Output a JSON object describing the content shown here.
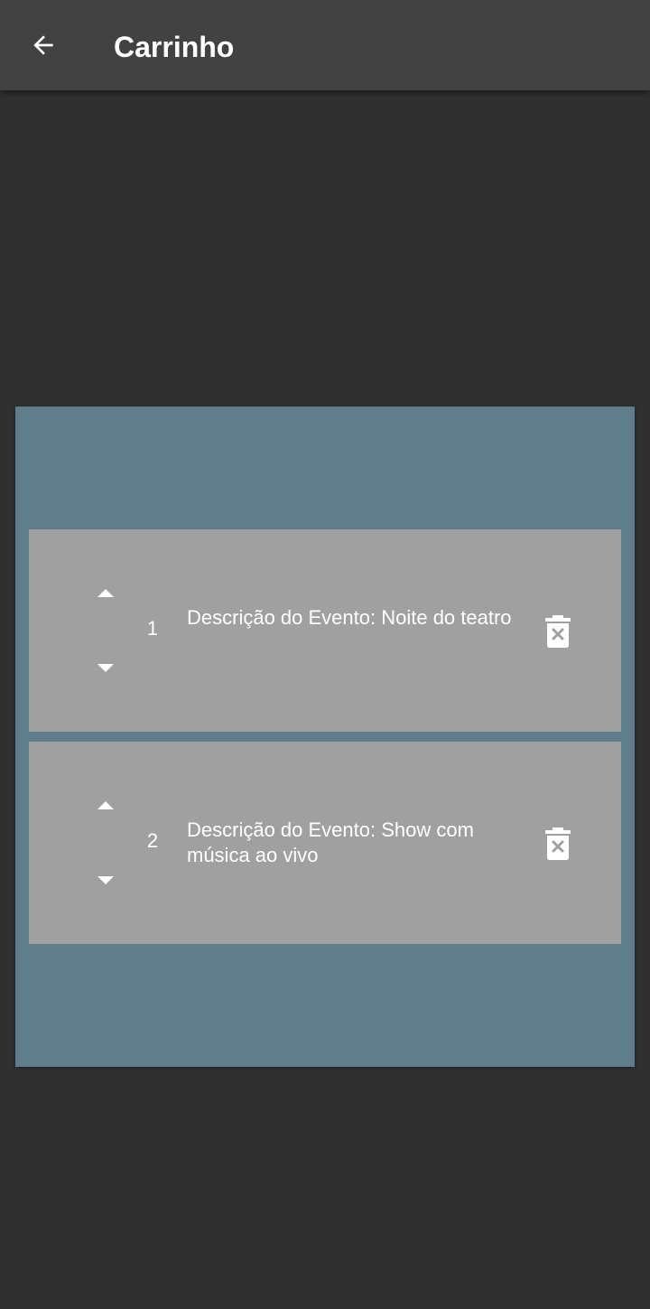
{
  "appbar": {
    "title": "Carrinho",
    "back_icon": "arrow-left-icon"
  },
  "cart": {
    "items": [
      {
        "quantity": "1",
        "description": "Descrição do Evento: Noite do teatro"
      },
      {
        "quantity": "2",
        "description": "Descrição do Evento: Show com música ao vivo"
      }
    ]
  },
  "colors": {
    "background": "#303030",
    "appbar": "#424242",
    "panel": "#607d8b",
    "card": "#a0a0a0",
    "text": "#ffffff"
  }
}
